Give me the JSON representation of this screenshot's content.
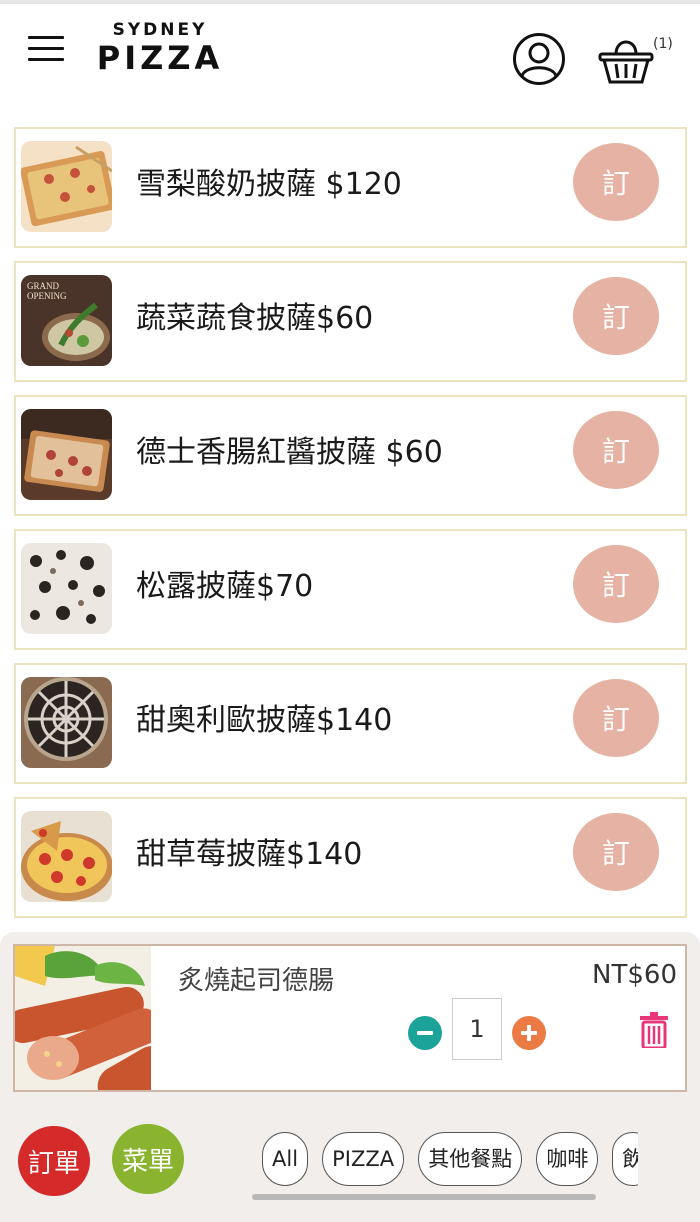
{
  "header": {
    "logo_top": "SYDNEY",
    "logo_main": "PIZZA",
    "cart_count": "(1)"
  },
  "menu_items": [
    {
      "name": "雪梨酸奶披薩 $120",
      "button": "訂"
    },
    {
      "name": "蔬菜蔬食披薩$60",
      "button": "訂",
      "thumb_text_1": "GRAND",
      "thumb_text_2": "OPENING"
    },
    {
      "name": "德士香腸紅醬披薩 $60",
      "button": "訂"
    },
    {
      "name": "松露披薩$70",
      "button": "訂"
    },
    {
      "name": "甜奧利歐披薩$140",
      "button": "訂"
    },
    {
      "name": "甜草莓披薩$140",
      "button": "訂"
    }
  ],
  "cart": {
    "item_name": "炙燒起司德腸",
    "price": "NT$60",
    "quantity": "1"
  },
  "bottom_nav": {
    "orders_label": "訂單",
    "menu_label": "菜單",
    "categories": [
      "All",
      "PIZZA",
      "其他餐點",
      "咖啡",
      "飲"
    ]
  },
  "colors": {
    "order_button": "#e5b2a3",
    "item_border": "#ece3bf",
    "orders_nav": "#d42a2a",
    "menu_nav": "#8ab32f",
    "qty_minus": "#1ba39a",
    "qty_plus": "#ec7a45",
    "trash": "#e8367a"
  },
  "icons": [
    "hamburger-icon",
    "user-icon",
    "basket-icon",
    "minus-icon",
    "plus-icon",
    "trash-icon"
  ]
}
